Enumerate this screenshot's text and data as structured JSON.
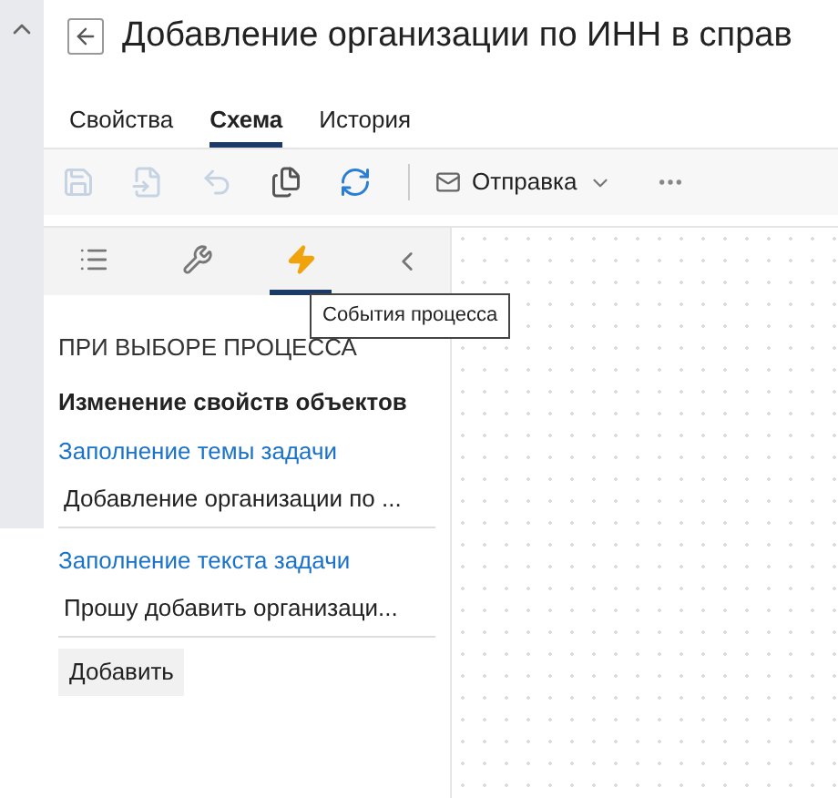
{
  "title": "Добавление организации по ИНН в справ",
  "tabs": [
    {
      "label": "Свойства",
      "selected": false
    },
    {
      "label": "Схема",
      "selected": true
    },
    {
      "label": "История",
      "selected": false
    }
  ],
  "toolbar": [
    {
      "kind": "save",
      "disabled": true
    },
    {
      "kind": "save-as",
      "disabled": true
    },
    {
      "kind": "undo",
      "disabled": true
    },
    {
      "kind": "copy",
      "disabled": false
    },
    {
      "kind": "refresh",
      "disabled": false
    }
  ],
  "send_menu": {
    "label": "Отправка"
  },
  "panel_tabs": [
    {
      "kind": "list",
      "selected": false
    },
    {
      "kind": "tools",
      "selected": false
    },
    {
      "kind": "events",
      "selected": true
    }
  ],
  "tooltip": "События процесса",
  "section": "ПРИ ВЫБОРЕ ПРОЦЕССА",
  "subsection": "Изменение свойств объектов",
  "fields": [
    {
      "label": "Заполнение темы задачи",
      "value": "Добавление организации по ..."
    },
    {
      "label": "Заполнение текста задачи",
      "value": "Прошу добавить организаци..."
    }
  ],
  "add_button": "Добавить"
}
